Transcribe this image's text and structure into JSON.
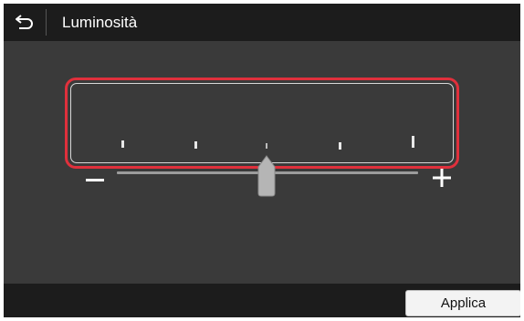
{
  "header": {
    "back_icon": "back-arrow-icon",
    "title": "Luminosità"
  },
  "brightness_slider": {
    "steps": 5,
    "current_step": 3,
    "level_fraction": 0.5,
    "minus_icon": "minus-icon",
    "plus_icon": "plus-icon",
    "highlight_color": "#e0303c"
  },
  "footer": {
    "apply_label": "Applica"
  },
  "colors": {
    "background": "#3a3a3a",
    "bars": "#1c1c1c",
    "thumb": "#b5b5b5"
  }
}
